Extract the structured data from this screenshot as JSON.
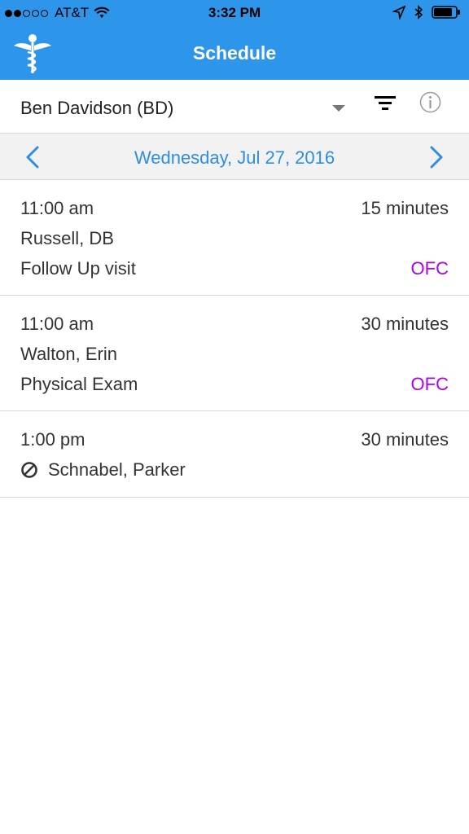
{
  "status_bar": {
    "carrier": "AT&T",
    "time": "3:32 PM",
    "signal_filled": 2,
    "signal_total": 5
  },
  "nav": {
    "title": "Schedule",
    "logo_icon": "caduceus-icon"
  },
  "provider": {
    "name": "Ben Davidson (BD)"
  },
  "date_bar": {
    "date": "Wednesday, Jul 27, 2016"
  },
  "appointments": [
    {
      "time": "11:00 am",
      "duration": "15 minutes",
      "patient": "Russell, DB",
      "type": "Follow Up visit",
      "location": "OFC"
    },
    {
      "time": "11:00 am",
      "duration": "30 minutes",
      "patient": "Walton, Erin",
      "type": "Physical Exam",
      "location": "OFC"
    },
    {
      "time": "1:00 pm",
      "duration": "30 minutes",
      "patient": "Schnabel, Parker",
      "status_icon": "no-show-icon"
    }
  ],
  "colors": {
    "header_blue": "#2e96ea",
    "date_blue": "#2e8ee0",
    "location_purple": "#b000f0"
  }
}
